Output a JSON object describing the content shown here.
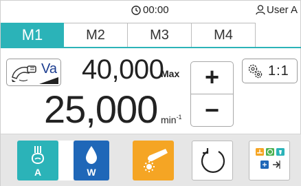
{
  "status": {
    "timer": "00:00",
    "user": "User A"
  },
  "tabs": [
    {
      "label": "M1",
      "active": true
    },
    {
      "label": "M2",
      "active": false
    },
    {
      "label": "M3",
      "active": false
    },
    {
      "label": "M4",
      "active": false
    }
  ],
  "mode": {
    "label": "Va",
    "icon": "handpiece-icon"
  },
  "speed": {
    "max_value": "40,000",
    "max_label": "Max",
    "current_value": "25,000",
    "unit": "min",
    "unit_exponent": "-1"
  },
  "stepper": {
    "plus": "+",
    "minus": "−"
  },
  "ratio": {
    "label": "1:1",
    "icon": "gear-icon"
  },
  "controls": {
    "air_label": "A",
    "water_label": "W",
    "light_icon": "light-icon",
    "rotation_icon": "rotation-icon",
    "settings_icon": "settings-panel-icon"
  },
  "colors": {
    "accent": "#2bb3b8",
    "water": "#1f67b8",
    "light": "#f5a524",
    "mode_label": "#1b3c8f"
  }
}
